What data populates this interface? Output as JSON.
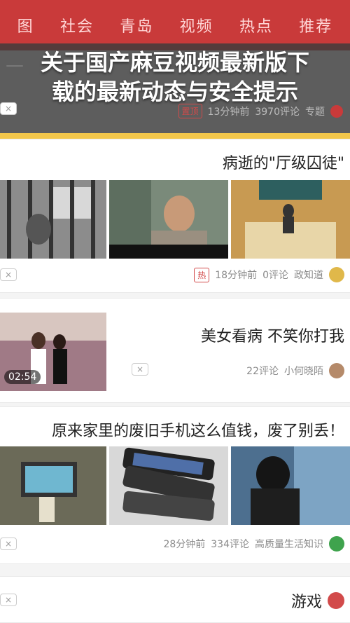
{
  "nav": {
    "tabs": [
      "图",
      "社会",
      "青岛",
      "视频",
      "热点",
      "推荐"
    ]
  },
  "overlay": {
    "headline_line1": "关于国产麻豆视频最新版下",
    "headline_line2": "载的最新动态与安全提示",
    "faded_text": "—",
    "meta": {
      "source": "专题",
      "comments": "3970评论",
      "time": "13分钟前",
      "badge": "置顶"
    }
  },
  "feed": [
    {
      "title": "病逝的\"厅级囚徒\"",
      "meta": {
        "source": "政知道",
        "comments": "0评论",
        "time": "18分钟前",
        "badge": "热"
      }
    },
    {
      "title": "美女看病 不笑你打我",
      "meta": {
        "source": "小何晓陌",
        "comments": "22评论"
      },
      "duration": "02:54"
    },
    {
      "title": "原来家里的废旧手机这么值钱，废了别丢！",
      "meta": {
        "source": "高质量生活知识",
        "comments": "334评论",
        "time": "28分钟前"
      }
    },
    {
      "title": "游戏"
    }
  ],
  "colors": {
    "nav_red": "#c93a3a",
    "accent_gold": "#f2c64a",
    "badge_red": "#d24a4a"
  }
}
